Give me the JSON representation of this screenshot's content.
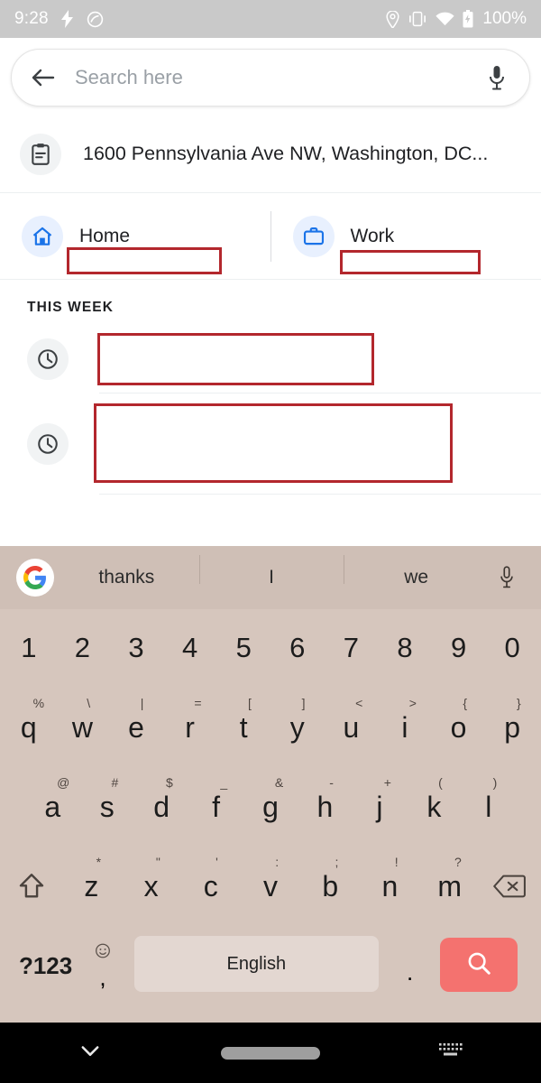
{
  "status_bar": {
    "time": "9:28",
    "battery_percent": "100%",
    "icons": [
      "bolt-icon",
      "do-not-disturb-icon",
      "location-pin-icon",
      "vibrate-icon",
      "wifi-icon",
      "battery-icon"
    ]
  },
  "search": {
    "placeholder": "Search here",
    "value": "",
    "back_icon": "back-arrow-icon",
    "mic_icon": "microphone-icon"
  },
  "clipboard_suggestion": {
    "icon": "clipboard-icon",
    "text": "1600 Pennsylvania Ave NW, Washington, DC..."
  },
  "shortcuts": [
    {
      "label": "Home",
      "icon": "home-icon",
      "value": ""
    },
    {
      "label": "Work",
      "icon": "briefcase-icon",
      "value": ""
    }
  ],
  "history": {
    "section_title": "THIS WEEK",
    "items": [
      {
        "icon": "clock-icon",
        "text": ""
      },
      {
        "icon": "clock-icon",
        "text": ""
      }
    ]
  },
  "keyboard": {
    "suggestions": [
      "thanks",
      "I",
      "we"
    ],
    "logo_icon": "google-g-icon",
    "mic_icon": "microphone-icon",
    "rows": [
      [
        {
          "main": "1"
        },
        {
          "main": "2"
        },
        {
          "main": "3"
        },
        {
          "main": "4"
        },
        {
          "main": "5"
        },
        {
          "main": "6"
        },
        {
          "main": "7"
        },
        {
          "main": "8"
        },
        {
          "main": "9"
        },
        {
          "main": "0"
        }
      ],
      [
        {
          "main": "q",
          "sup": "%"
        },
        {
          "main": "w",
          "sup": "\\"
        },
        {
          "main": "e",
          "sup": "|"
        },
        {
          "main": "r",
          "sup": "="
        },
        {
          "main": "t",
          "sup": "["
        },
        {
          "main": "y",
          "sup": "]"
        },
        {
          "main": "u",
          "sup": "<"
        },
        {
          "main": "i",
          "sup": ">"
        },
        {
          "main": "o",
          "sup": "{"
        },
        {
          "main": "p",
          "sup": "}"
        }
      ],
      [
        {
          "main": "a",
          "sup": "@"
        },
        {
          "main": "s",
          "sup": "#"
        },
        {
          "main": "d",
          "sup": "$"
        },
        {
          "main": "f",
          "sup": "_"
        },
        {
          "main": "g",
          "sup": "&"
        },
        {
          "main": "h",
          "sup": "-"
        },
        {
          "main": "j",
          "sup": "+"
        },
        {
          "main": "k",
          "sup": "("
        },
        {
          "main": "l",
          "sup": ")"
        }
      ],
      [
        {
          "main": "z",
          "sup": "*"
        },
        {
          "main": "x",
          "sup": "\""
        },
        {
          "main": "c",
          "sup": "'"
        },
        {
          "main": "v",
          "sup": ":"
        },
        {
          "main": "b",
          "sup": ";"
        },
        {
          "main": "n",
          "sup": "!"
        },
        {
          "main": "m",
          "sup": "?"
        }
      ]
    ],
    "shift_icon": "shift-icon",
    "backspace_icon": "backspace-icon",
    "symbols_label": "?123",
    "comma_label": ",",
    "emoji_icon": "emoji-icon",
    "space_label": "English",
    "period_label": ".",
    "enter_icon": "search-icon",
    "enter_color": "#f4726f"
  },
  "nav_bar": {
    "hide_keyboard_icon": "chevron-down-icon",
    "home_icon": "home-pill-icon",
    "switch_keyboard_icon": "keyboard-icon"
  },
  "colors": {
    "redaction_border": "#b3272d",
    "accent_blue": "#1a73e8",
    "keyboard_bg": "#d6c6bd"
  }
}
